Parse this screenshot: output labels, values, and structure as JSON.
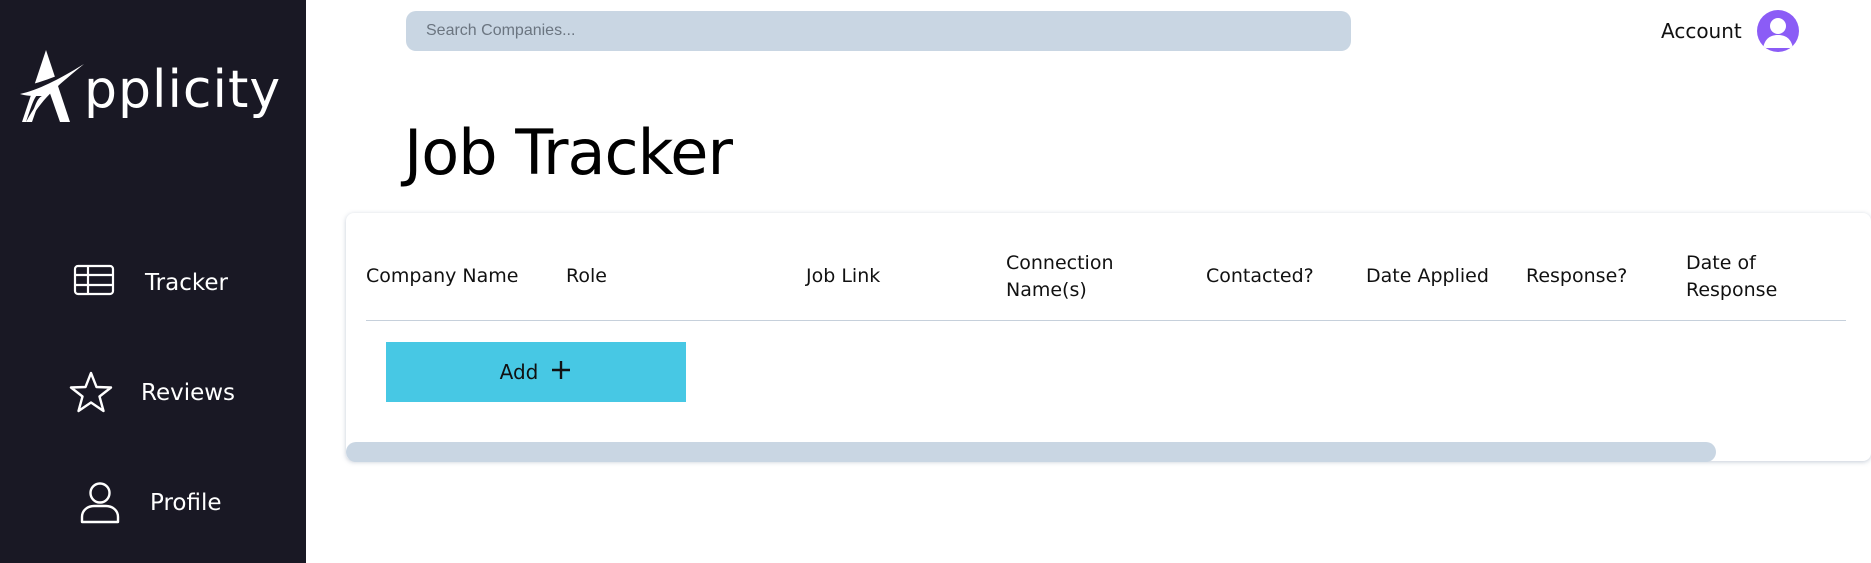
{
  "sidebar": {
    "brand": "pplicity",
    "items": [
      {
        "label": "Tracker",
        "icon": "table-icon"
      },
      {
        "label": "Reviews",
        "icon": "star-icon"
      },
      {
        "label": "Profile",
        "icon": "user-icon"
      }
    ]
  },
  "header": {
    "search_placeholder": "Search Companies...",
    "account_label": "Account",
    "avatar_color": "#8b5cf6"
  },
  "main": {
    "title": "Job Tracker",
    "columns": [
      "Company Name",
      "Role",
      "Job Link",
      "Connection Name(s)",
      "Contacted?",
      "Date Applied",
      "Response?",
      "Date of Response"
    ],
    "add_label": "Add",
    "add_icon": "plus-icon"
  },
  "colors": {
    "sidebar_bg": "#191824",
    "search_bg": "#c9d6e3",
    "add_button": "#47c8e4",
    "scrollbar": "#c9d6e3"
  }
}
